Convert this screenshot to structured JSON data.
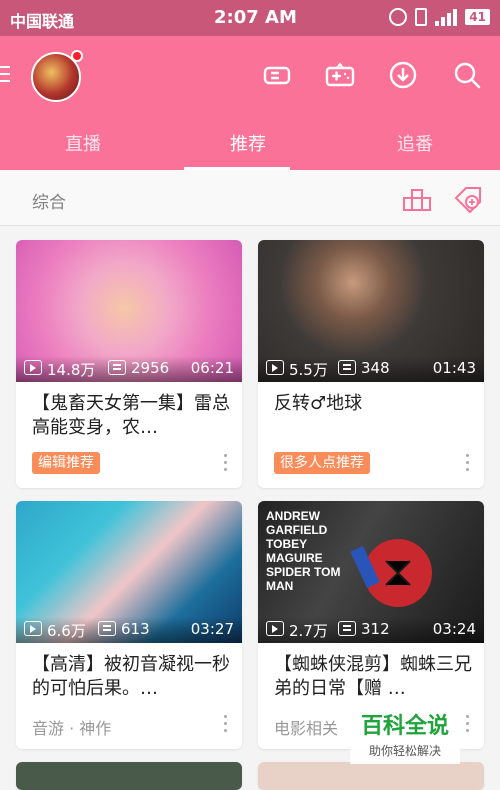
{
  "status_bar": {
    "carrier": "中国联通",
    "time": "2:07 AM",
    "battery": "41"
  },
  "header": {
    "tabs": [
      "直播",
      "推荐",
      "追番"
    ],
    "active_tab": 1
  },
  "subbar": {
    "label": "综合"
  },
  "cards": [
    {
      "views": "14.8万",
      "danmaku": "2956",
      "duration": "06:21",
      "title": "【鬼畜天女第一集】雷总高能变身，农…",
      "tag": "编辑推荐",
      "subtext": ""
    },
    {
      "views": "5.5万",
      "danmaku": "348",
      "duration": "01:43",
      "title": "反转♂地球",
      "tag": "很多人点推荐",
      "subtext": ""
    },
    {
      "views": "6.6万",
      "danmaku": "613",
      "duration": "03:27",
      "title": "【高清】被初音凝视一秒的可怕后果。…",
      "tag": "",
      "subtext": "音游 · 神作"
    },
    {
      "views": "2.7万",
      "danmaku": "312",
      "duration": "03:24",
      "title": "【蜘蛛侠混剪】蜘蛛三兄弟的日常【赠 …",
      "tag": "",
      "subtext": "电影相关"
    }
  ],
  "watermark": {
    "title": "百科全说",
    "subtitle": "助你轻松解决"
  },
  "thumb_texts": {
    "card4": "ANDREW GARFIELD TOBEY MAGUIRE SPIDER TOM MAN"
  },
  "colors": {
    "header": "#fb7299",
    "status": "#c9577a",
    "tag": "#fa8c5a"
  }
}
